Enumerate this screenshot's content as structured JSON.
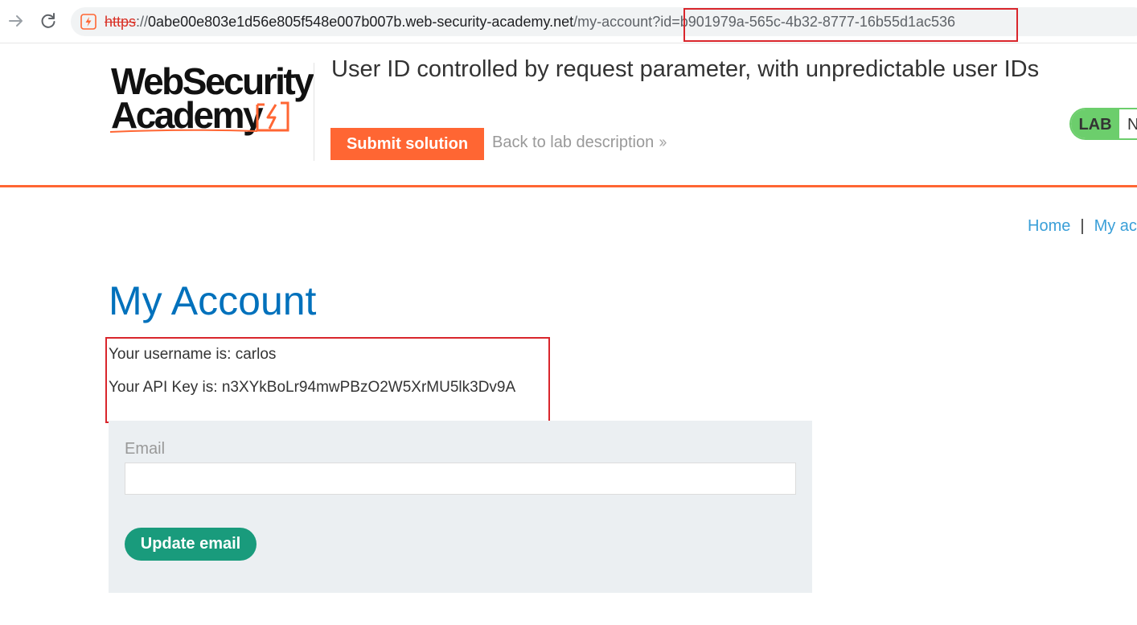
{
  "browser": {
    "url_scheme": "https",
    "url_sep": "://",
    "url_host": "0abe00e803e1d56e805f548e007b007b.web-security-academy.net",
    "url_path": "/my-account",
    "url_query": "?id=b901979a-565c-4b32-8777-16b55d1ac536",
    "site_icon": "lightning-bolt-icon",
    "forward_icon": "arrow-right-icon",
    "reload_icon": "reload-icon"
  },
  "header": {
    "logo_line1": "WebSecurity",
    "logo_line2": "Academy",
    "lab_title": "User ID controlled by request parameter, with unpredictable user IDs",
    "submit_label": "Submit solution",
    "back_label": "Back to lab description",
    "back_icon": "double-chevron-right-icon",
    "lab_badge": "LAB",
    "lab_status_text": "N"
  },
  "nav": {
    "home": "Home",
    "separator": "|",
    "my_account": "My ac"
  },
  "account": {
    "title": "My Account",
    "username_line": "Your username is: carlos",
    "apikey_line": "Your API Key is: n3XYkBoLr94mwPBzO2W5XrMU5lk3Dv9A",
    "email_label": "Email",
    "email_value": "",
    "update_label": "Update email"
  },
  "colors": {
    "accent": "#ff6633",
    "title_blue": "#0071bc",
    "link_blue": "#3a9fd8",
    "lab_green": "#6cce6c",
    "button_green": "#199b7c",
    "highlight_red": "#d9262c",
    "panel_bg": "#ebeff2"
  }
}
